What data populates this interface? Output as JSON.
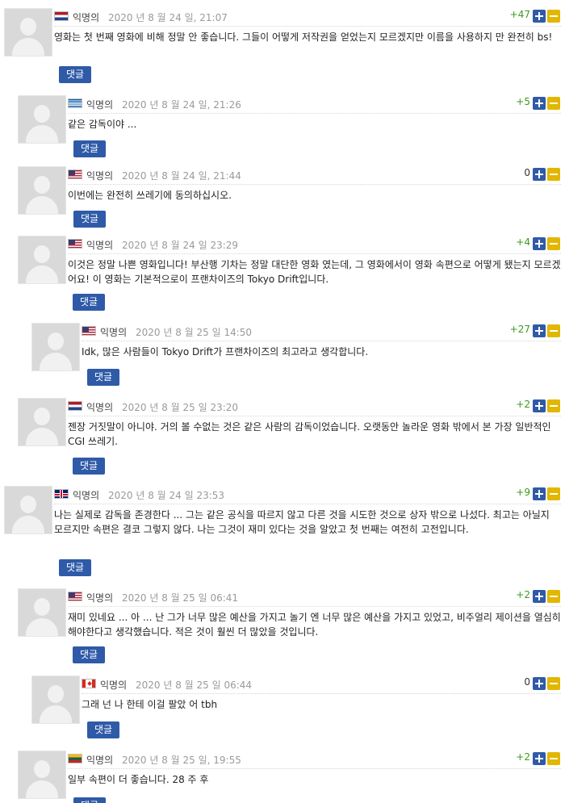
{
  "thread": {
    "reply_label": "댓글",
    "comments": [
      {
        "author": "익명의",
        "country": "Netherlands",
        "date": "2020 년 8 월 24 일, 21:07",
        "score": "+47",
        "text": "영화는 첫 번째 영화에 비해 정말 안 좋습니다. 그들이 어떻게 저작권을 얻었는지 모르겠지만 이름을 사용하지 만 완전히 bs!"
      },
      {
        "author": "익명의",
        "country": "Greece",
        "date": "2020 년 8 월 24 일, 21:26",
        "score": "+5",
        "text": "같은 감독이야 ..."
      },
      {
        "author": "익명의",
        "country": "United States",
        "date": "2020 년 8 월 24 일, 21:44",
        "score": "0",
        "text": "이번에는 완전히 쓰레기에 동의하십시오."
      },
      {
        "author": "익명의",
        "country": "United States",
        "date": "2020 년 8 월 24 일 23:29",
        "score": "+4",
        "text": "이것은 정말 나쁜 영화입니다! 부산행 기차는 정말 대단한 영화 였는데, 그 영화에서이 영화 속편으로 어떻게 됐는지 모르겠어요! 이 영화는 기본적으로이 프랜차이즈의 Tokyo Drift입니다."
      },
      {
        "author": "익명의",
        "country": "United States",
        "date": "2020 년 8 월 25 일 14:50",
        "score": "+27",
        "text": "Idk, 많은 사람들이 Tokyo Drift가 프랜차이즈의 최고라고 생각합니다."
      },
      {
        "author": "익명의",
        "country": "Netherlands",
        "date": "2020 년 8 월 25 일 23:20",
        "score": "+2",
        "text": "젠장 거짓말이 아니야. 거의 볼 수없는 것은 같은 사람의 감독이었습니다. 오랫동안 놀라운 영화 밖에서 본 가장 일반적인 CGI 쓰레기."
      },
      {
        "author": "익명의",
        "country": "United Kingdom",
        "date": "2020 년 8 월 24 일 23:53",
        "score": "+9",
        "text": "나는 실제로 감독을 존경한다 ... 그는 같은 공식을 따르지 않고 다른 것을 시도한 것으로 상자 밖으로 나섰다. 최고는 아닐지 모르지만 속편은 결코 그렇지 않다. 나는 그것이 재미 있다는 것을 알았고 첫 번째는 여전히 고전입니다."
      },
      {
        "author": "익명의",
        "country": "United States",
        "date": "2020 년 8 월 25 일 06:41",
        "score": "+2",
        "text": "재미 있네요 ... 아 ... 난 그가 너무 많은 예산을 가지고 놀기 엔 너무 많은 예산을 가지고 있었고, 비주얼리 제이션을 열심히해야한다고 생각했습니다. 적은 것이 훨씬 더 많았을 것입니다."
      },
      {
        "author": "익명의",
        "country": "Canada",
        "date": "2020 년 8 월 25 일 06:44",
        "score": "0",
        "text": "그래 넌 나 한테 이걸 팔았 어 tbh"
      },
      {
        "author": "익명의",
        "country": "Lithuania",
        "date": "2020 년 8 월 25 일, 19:55",
        "score": "+2",
        "text": "일부 속편이 더 좋습니다. 28 주 후"
      }
    ]
  }
}
